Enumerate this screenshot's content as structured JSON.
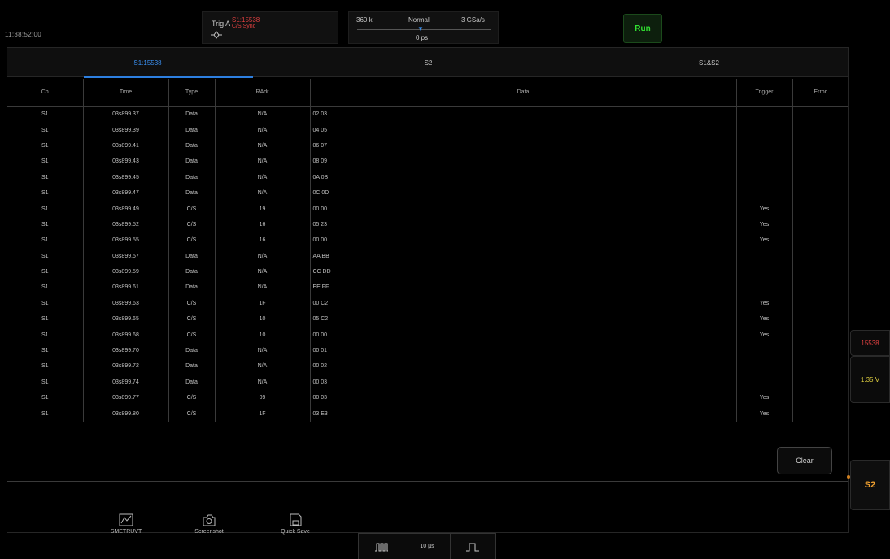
{
  "status": {
    "clock": "11:38:52:00"
  },
  "trigger": {
    "label": "Trig A",
    "source": "S1:15538",
    "condition": "C/S Sync"
  },
  "acquisition": {
    "memory_depth": "360 k",
    "mode": "Normal",
    "sample_rate": "3 GSa/s",
    "delay": "0 ps"
  },
  "run_button": "Run",
  "tabs": [
    {
      "label": "S1:15538",
      "active": true
    },
    {
      "label": "S2",
      "active": false
    },
    {
      "label": "S1&S2",
      "active": false
    }
  ],
  "table": {
    "headers": [
      "Ch",
      "Time",
      "Type",
      "RAdr",
      "Data",
      "Trigger",
      "Error"
    ],
    "rows": [
      [
        "S1",
        "03s899.37",
        "Data",
        "N/A",
        "02 03",
        "",
        ""
      ],
      [
        "S1",
        "03s899.39",
        "Data",
        "N/A",
        "04 05",
        "",
        ""
      ],
      [
        "S1",
        "03s899.41",
        "Data",
        "N/A",
        "06 07",
        "",
        ""
      ],
      [
        "S1",
        "03s899.43",
        "Data",
        "N/A",
        "08 09",
        "",
        ""
      ],
      [
        "S1",
        "03s899.45",
        "Data",
        "N/A",
        "0A 0B",
        "",
        ""
      ],
      [
        "S1",
        "03s899.47",
        "Data",
        "N/A",
        "0C 0D",
        "",
        ""
      ],
      [
        "S1",
        "03s899.49",
        "C/S",
        "19",
        "00 00",
        "Yes",
        ""
      ],
      [
        "S1",
        "03s899.52",
        "C/S",
        "16",
        "05 23",
        "Yes",
        ""
      ],
      [
        "S1",
        "03s899.55",
        "C/S",
        "16",
        "00 00",
        "Yes",
        ""
      ],
      [
        "S1",
        "03s899.57",
        "Data",
        "N/A",
        "AA BB",
        "",
        ""
      ],
      [
        "S1",
        "03s899.59",
        "Data",
        "N/A",
        "CC DD",
        "",
        ""
      ],
      [
        "S1",
        "03s899.61",
        "Data",
        "N/A",
        "EE FF",
        "",
        ""
      ],
      [
        "S1",
        "03s899.63",
        "C/S",
        "1F",
        "00 C2",
        "Yes",
        ""
      ],
      [
        "S1",
        "03s899.65",
        "C/S",
        "10",
        "05 C2",
        "Yes",
        ""
      ],
      [
        "S1",
        "03s899.68",
        "C/S",
        "10",
        "00 00",
        "Yes",
        ""
      ],
      [
        "S1",
        "03s899.70",
        "Data",
        "N/A",
        "00 01",
        "",
        ""
      ],
      [
        "S1",
        "03s899.72",
        "Data",
        "N/A",
        "00 02",
        "",
        ""
      ],
      [
        "S1",
        "03s899.74",
        "Data",
        "N/A",
        "00 03",
        "",
        ""
      ],
      [
        "S1",
        "03s899.77",
        "C/S",
        "09",
        "00 03",
        "Yes",
        ""
      ],
      [
        "S1",
        "03s899.80",
        "C/S",
        "1F",
        "03 E3",
        "Yes",
        ""
      ]
    ]
  },
  "clear_button": "Clear",
  "side": {
    "value": "15538",
    "level": "1.35 V",
    "channel": "S2"
  },
  "toolbar": {
    "smart_label": "SMETRUVT",
    "screenshot_label": "Screenshot",
    "quick_save_label": "Quick Save",
    "timebase": "10 µs"
  },
  "colors": {
    "accent_blue": "#3a8ff0",
    "run_green": "#31e031",
    "trigger_red": "#e04040",
    "level_yellow": "#e0d040",
    "s2_orange": "#f0a030"
  }
}
